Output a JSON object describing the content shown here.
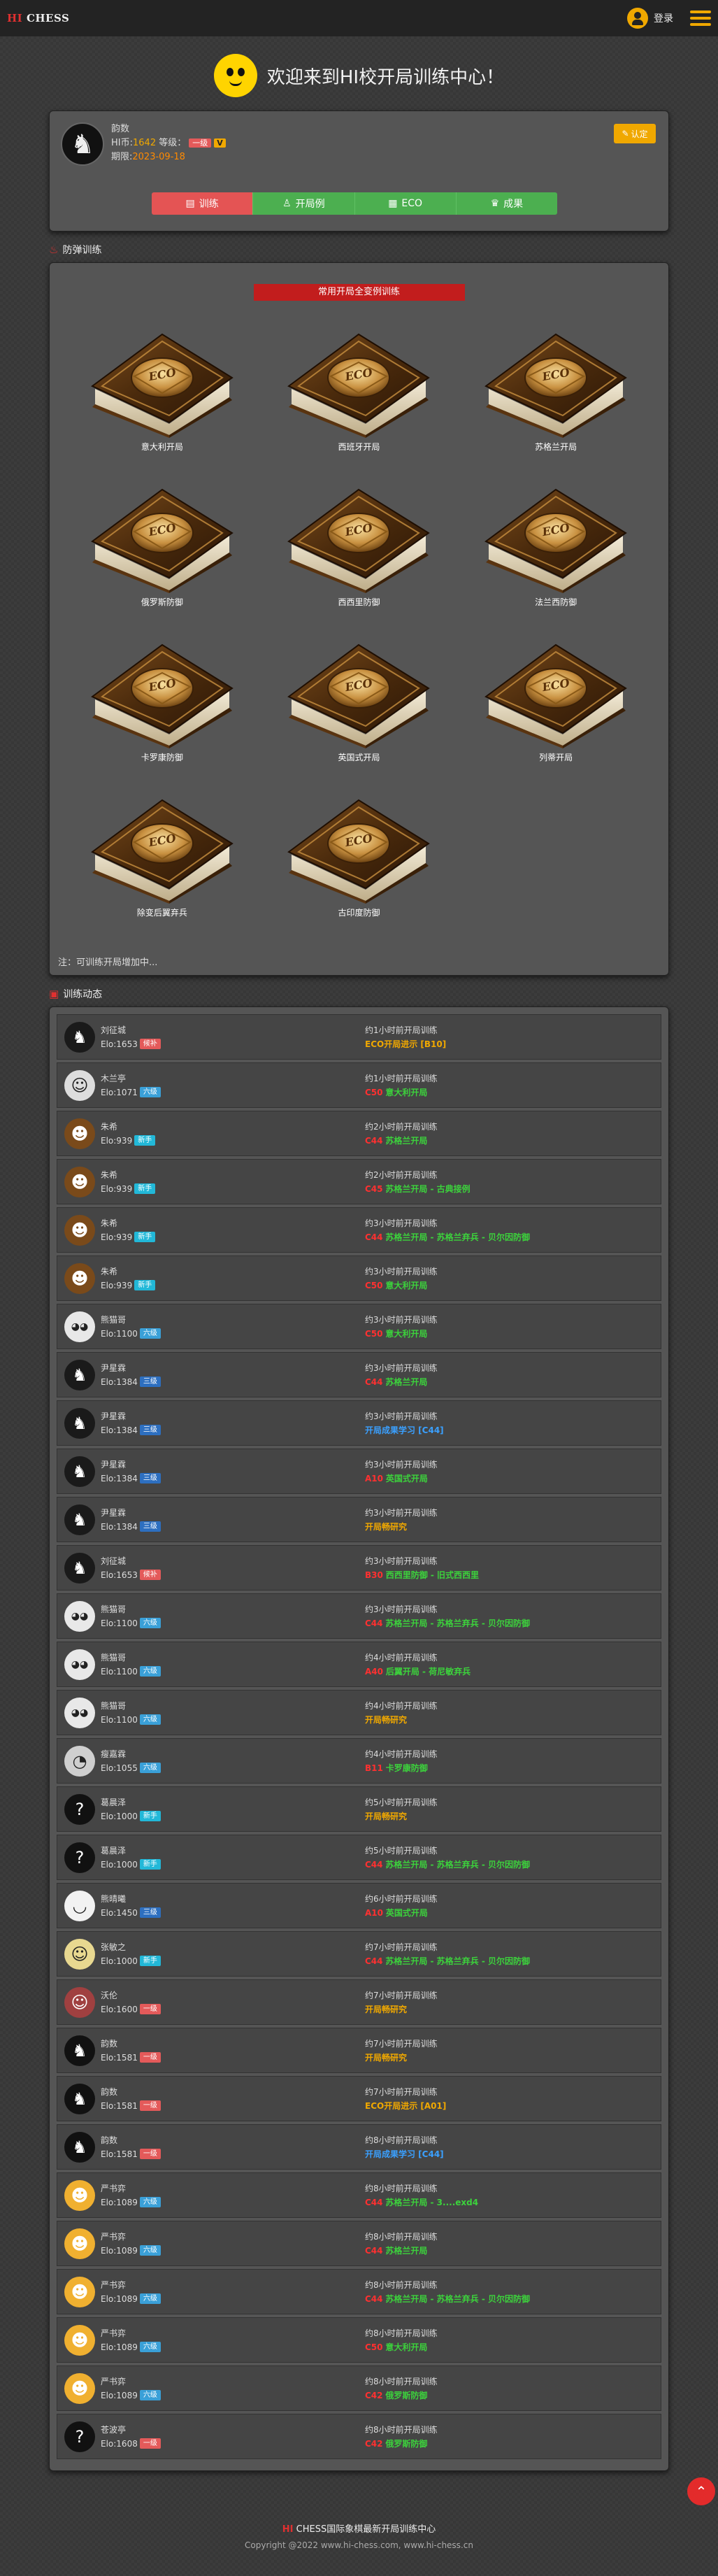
{
  "header": {
    "logo_hi": "HI",
    "logo_chess": "CHESS",
    "login_label": "登录"
  },
  "welcome": {
    "text": "欢迎来到HI校开局训练中心！"
  },
  "profile": {
    "name": "韵数",
    "coin_label": "HI币:",
    "coin_value": "1642",
    "level_label": "等级：",
    "level_badge": "一级",
    "v_badge": "V",
    "expire_label": "期限:",
    "expire_value": "2023-09-18",
    "edit_label": "认定",
    "tabs": [
      {
        "label": "训练",
        "icon": "▤"
      },
      {
        "label": "开局例",
        "icon": "♙"
      },
      {
        "label": "ECO",
        "icon": "▦"
      },
      {
        "label": "成果",
        "icon": "♛"
      }
    ]
  },
  "defense": {
    "section_title": "防弹训练",
    "banner": "常用开局全变例训练",
    "book_text": "ECO",
    "books": [
      "意大利开局",
      "西班牙开局",
      "苏格兰开局",
      "俄罗斯防御",
      "西西里防御",
      "法兰西防御",
      "卡罗康防御",
      "英国式开局",
      "列蒂开局",
      "除变后翼弃兵",
      "古印度防御"
    ],
    "note": "注：可训练开局增加中..."
  },
  "activity": {
    "section_title": "训练动态",
    "rows": [
      {
        "name": "刘征城",
        "elo": "Elo:1653",
        "rank": "候补",
        "rank_color": "#e45a5a",
        "avatar": "♞",
        "avatar_bg": "#1a1a1a",
        "time": "约1小时前开局训练",
        "code": "",
        "code_color": "#f0a800",
        "desc": "ECO开局进示 [B10]",
        "desc_color": "#f0a800"
      },
      {
        "name": "木兰亭",
        "elo": "Elo:1071",
        "rank": "六级",
        "rank_color": "#3aa0d8",
        "avatar": "☺",
        "avatar_bg": "#dddddd",
        "time": "约1小时前开局训练",
        "code": "C50",
        "code_color": "#ff3030",
        "desc": "意大利开局",
        "desc_color": "#3cd23c"
      },
      {
        "name": "朱希",
        "elo": "Elo:939",
        "rank": "新手",
        "rank_color": "#22b8d8",
        "avatar": "☻",
        "avatar_bg": "#7a4a1a",
        "time": "约2小时前开局训练",
        "code": "C44",
        "code_color": "#ff3030",
        "desc": "苏格兰开局",
        "desc_color": "#3cd23c"
      },
      {
        "name": "朱希",
        "elo": "Elo:939",
        "rank": "新手",
        "rank_color": "#22b8d8",
        "avatar": "☻",
        "avatar_bg": "#7a4a1a",
        "time": "约2小时前开局训练",
        "code": "C45",
        "code_color": "#ff3030",
        "desc": "苏格兰开局 - 古典接例",
        "desc_color": "#3cd23c"
      },
      {
        "name": "朱希",
        "elo": "Elo:939",
        "rank": "新手",
        "rank_color": "#22b8d8",
        "avatar": "☻",
        "avatar_bg": "#7a4a1a",
        "time": "约3小时前开局训练",
        "code": "C44",
        "code_color": "#ff3030",
        "desc": "苏格兰开局 - 苏格兰弃兵 - 贝尔因防御",
        "desc_color": "#3cd23c"
      },
      {
        "name": "朱希",
        "elo": "Elo:939",
        "rank": "新手",
        "rank_color": "#22b8d8",
        "avatar": "☻",
        "avatar_bg": "#7a4a1a",
        "time": "约3小时前开局训练",
        "code": "C50",
        "code_color": "#ff3030",
        "desc": "意大利开局",
        "desc_color": "#3cd23c"
      },
      {
        "name": "熊猫哥",
        "elo": "Elo:1100",
        "rank": "六级",
        "rank_color": "#3aa0d8",
        "avatar": "◕◕",
        "avatar_bg": "#e8e8e8",
        "time": "约3小时前开局训练",
        "code": "C50",
        "code_color": "#ff3030",
        "desc": "意大利开局",
        "desc_color": "#3cd23c"
      },
      {
        "name": "尹星霖",
        "elo": "Elo:1384",
        "rank": "三级",
        "rank_color": "#2d6fc0",
        "avatar": "♞",
        "avatar_bg": "#1a1a1a",
        "time": "约3小时前开局训练",
        "code": "C44",
        "code_color": "#ff3030",
        "desc": "苏格兰开局",
        "desc_color": "#3cd23c"
      },
      {
        "name": "尹星霖",
        "elo": "Elo:1384",
        "rank": "三级",
        "rank_color": "#2d6fc0",
        "avatar": "♞",
        "avatar_bg": "#1a1a1a",
        "time": "约3小时前开局训练",
        "code": "",
        "code_color": "#3aa0ff",
        "desc": "开局成果学习 [C44]",
        "desc_color": "#3aa0ff"
      },
      {
        "name": "尹星霖",
        "elo": "Elo:1384",
        "rank": "三级",
        "rank_color": "#2d6fc0",
        "avatar": "♞",
        "avatar_bg": "#1a1a1a",
        "time": "约3小时前开局训练",
        "code": "A10",
        "code_color": "#ff3030",
        "desc": "英国式开局",
        "desc_color": "#3cd23c"
      },
      {
        "name": "尹星霖",
        "elo": "Elo:1384",
        "rank": "三级",
        "rank_color": "#2d6fc0",
        "avatar": "♞",
        "avatar_bg": "#1a1a1a",
        "time": "约3小时前开局训练",
        "code": "",
        "code_color": "#f0a800",
        "desc": "开局畅研究",
        "desc_color": "#f0a800"
      },
      {
        "name": "刘征城",
        "elo": "Elo:1653",
        "rank": "候补",
        "rank_color": "#e45a5a",
        "avatar": "♞",
        "avatar_bg": "#1a1a1a",
        "time": "约3小时前开局训练",
        "code": "B30",
        "code_color": "#ff3030",
        "desc": "西西里防御 - 旧式西西里",
        "desc_color": "#3cd23c"
      },
      {
        "name": "熊猫哥",
        "elo": "Elo:1100",
        "rank": "六级",
        "rank_color": "#3aa0d8",
        "avatar": "◕◕",
        "avatar_bg": "#e8e8e8",
        "time": "约3小时前开局训练",
        "code": "C44",
        "code_color": "#ff3030",
        "desc": "苏格兰开局 - 苏格兰弃兵 - 贝尔因防御",
        "desc_color": "#3cd23c"
      },
      {
        "name": "熊猫哥",
        "elo": "Elo:1100",
        "rank": "六级",
        "rank_color": "#3aa0d8",
        "avatar": "◕◕",
        "avatar_bg": "#e8e8e8",
        "time": "约4小时前开局训练",
        "code": "A40",
        "code_color": "#ff3030",
        "desc": "后翼开局 - 荷尼敏弃兵",
        "desc_color": "#3cd23c"
      },
      {
        "name": "熊猫哥",
        "elo": "Elo:1100",
        "rank": "六级",
        "rank_color": "#3aa0d8",
        "avatar": "◕◕",
        "avatar_bg": "#e8e8e8",
        "time": "约4小时前开局训练",
        "code": "",
        "code_color": "#f0a800",
        "desc": "开局畅研究",
        "desc_color": "#f0a800"
      },
      {
        "name": "瘦嘉霖",
        "elo": "Elo:1055",
        "rank": "六级",
        "rank_color": "#3aa0d8",
        "avatar": "◔",
        "avatar_bg": "#cfcfcf",
        "time": "约4小时前开局训练",
        "code": "B11",
        "code_color": "#ff3030",
        "desc": "卡罗康防御",
        "desc_color": "#3cd23c"
      },
      {
        "name": "葛晨泽",
        "elo": "Elo:1000",
        "rank": "新手",
        "rank_color": "#22b8d8",
        "avatar": "?",
        "avatar_bg": "#111111",
        "time": "约5小时前开局训练",
        "code": "",
        "code_color": "#f0a800",
        "desc": "开局畅研究",
        "desc_color": "#f0a800"
      },
      {
        "name": "葛晨泽",
        "elo": "Elo:1000",
        "rank": "新手",
        "rank_color": "#22b8d8",
        "avatar": "?",
        "avatar_bg": "#111111",
        "time": "约5小时前开局训练",
        "code": "C44",
        "code_color": "#ff3030",
        "desc": "苏格兰开局 - 苏格兰弃兵 - 贝尔因防御",
        "desc_color": "#3cd23c"
      },
      {
        "name": "熊晴曦",
        "elo": "Elo:1450",
        "rank": "三级",
        "rank_color": "#2d6fc0",
        "avatar": "◡",
        "avatar_bg": "#f2f2f2",
        "time": "约6小时前开局训练",
        "code": "A10",
        "code_color": "#ff3030",
        "desc": "英国式开局",
        "desc_color": "#3cd23c"
      },
      {
        "name": "张敏之",
        "elo": "Elo:1000",
        "rank": "新手",
        "rank_color": "#22b8d8",
        "avatar": "☺",
        "avatar_bg": "#e8d890",
        "time": "约7小时前开局训练",
        "code": "C44",
        "code_color": "#ff3030",
        "desc": "苏格兰开局 - 苏格兰弃兵 - 贝尔因防御",
        "desc_color": "#3cd23c"
      },
      {
        "name": "沃伦",
        "elo": "Elo:1600",
        "rank": "一级",
        "rank_color": "#e45a5a",
        "avatar": "☺",
        "avatar_bg": "#a04040",
        "time": "约7小时前开局训练",
        "code": "",
        "code_color": "#f0a800",
        "desc": "开局畅研究",
        "desc_color": "#f0a800"
      },
      {
        "name": "韵数",
        "elo": "Elo:1581",
        "rank": "一级",
        "rank_color": "#e45a5a",
        "avatar": "♞",
        "avatar_bg": "#111111",
        "time": "约7小时前开局训练",
        "code": "",
        "code_color": "#f0a800",
        "desc": "开局畅研究",
        "desc_color": "#f0a800"
      },
      {
        "name": "韵数",
        "elo": "Elo:1581",
        "rank": "一级",
        "rank_color": "#e45a5a",
        "avatar": "♞",
        "avatar_bg": "#111111",
        "time": "约7小时前开局训练",
        "code": "",
        "code_color": "#f0a800",
        "desc": "ECO开局进示 [A01]",
        "desc_color": "#f0a800"
      },
      {
        "name": "韵数",
        "elo": "Elo:1581",
        "rank": "一级",
        "rank_color": "#e45a5a",
        "avatar": "♞",
        "avatar_bg": "#111111",
        "time": "约8小时前开局训练",
        "code": "",
        "code_color": "#3aa0ff",
        "desc": "开局成果学习 [C44]",
        "desc_color": "#3aa0ff"
      },
      {
        "name": "严书弈",
        "elo": "Elo:1089",
        "rank": "六级",
        "rank_color": "#3aa0d8",
        "avatar": "☻",
        "avatar_bg": "#f0b030",
        "time": "约8小时前开局训练",
        "code": "C44",
        "code_color": "#ff3030",
        "desc": "苏格兰开局 - 3....exd4",
        "desc_color": "#3cd23c"
      },
      {
        "name": "严书弈",
        "elo": "Elo:1089",
        "rank": "六级",
        "rank_color": "#3aa0d8",
        "avatar": "☻",
        "avatar_bg": "#f0b030",
        "time": "约8小时前开局训练",
        "code": "C44",
        "code_color": "#ff3030",
        "desc": "苏格兰开局",
        "desc_color": "#3cd23c"
      },
      {
        "name": "严书弈",
        "elo": "Elo:1089",
        "rank": "六级",
        "rank_color": "#3aa0d8",
        "avatar": "☻",
        "avatar_bg": "#f0b030",
        "time": "约8小时前开局训练",
        "code": "C44",
        "code_color": "#ff3030",
        "desc": "苏格兰开局 - 苏格兰弃兵 - 贝尔因防御",
        "desc_color": "#3cd23c"
      },
      {
        "name": "严书弈",
        "elo": "Elo:1089",
        "rank": "六级",
        "rank_color": "#3aa0d8",
        "avatar": "☻",
        "avatar_bg": "#f0b030",
        "time": "约8小时前开局训练",
        "code": "C50",
        "code_color": "#ff3030",
        "desc": "意大利开局",
        "desc_color": "#3cd23c"
      },
      {
        "name": "严书弈",
        "elo": "Elo:1089",
        "rank": "六级",
        "rank_color": "#3aa0d8",
        "avatar": "☻",
        "avatar_bg": "#f0b030",
        "time": "约8小时前开局训练",
        "code": "C42",
        "code_color": "#ff3030",
        "desc": "俄罗斯防御",
        "desc_color": "#3cd23c"
      },
      {
        "name": "苍波亭",
        "elo": "Elo:1608",
        "rank": "一级",
        "rank_color": "#e45a5a",
        "avatar": "?",
        "avatar_bg": "#111111",
        "time": "约8小时前开局训练",
        "code": "C42",
        "code_color": "#ff3030",
        "desc": "俄罗斯防御",
        "desc_color": "#3cd23c"
      }
    ]
  },
  "footer": {
    "title_hi": "HI",
    "title_rest": "CHESS国际象棋最新开局训练中心",
    "copyright": "Copyright @2022 www.hi-chess.com, www.hi-chess.cn"
  }
}
